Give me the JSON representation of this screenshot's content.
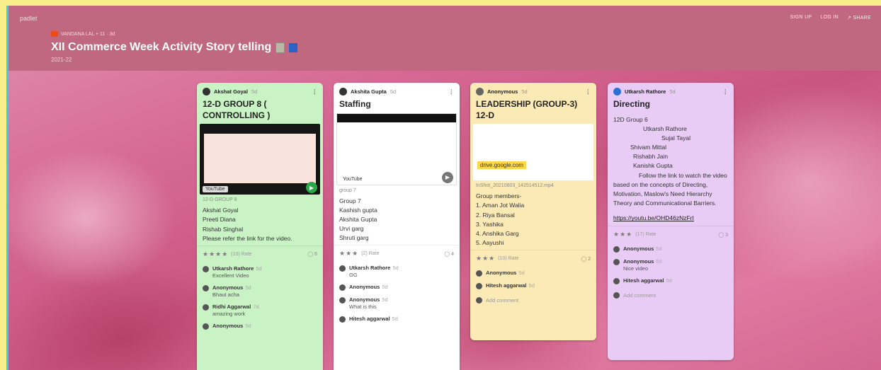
{
  "header": {
    "logo": "padlet",
    "author_line": "VANDANA LAL  +  11  ·  3d",
    "title": "XII Commerce Week Activity Story telling",
    "year": "2021-22",
    "actions": [
      "SIGN UP",
      "LOG IN",
      "SHARE"
    ]
  },
  "cards": [
    {
      "author": "Akshat Goyal",
      "time": "5d",
      "title": "12-D GROUP 8 ( CONTROLLING )",
      "thumb_label": "YouTube",
      "caption": "12-D GROUP 8",
      "body": [
        "Akshat Goyal",
        "Preeti Diana",
        "Rishab Singhal",
        "Please refer the link for the video."
      ],
      "rating_text": "(10) Rate",
      "comment_count": "6",
      "comments": [
        {
          "name": "Utkarsh Rathore",
          "time": "5d",
          "text": "Excellent Video"
        },
        {
          "name": "Anonymous",
          "time": "5d",
          "text": "Bhaut acha"
        },
        {
          "name": "Ridhi Aggarwal",
          "time": "7d",
          "text": "amazing work"
        },
        {
          "name": "Anonymous",
          "time": "5d",
          "text": ""
        }
      ]
    },
    {
      "author": "Akshita Gupta",
      "time": "5d",
      "title": "Staffing",
      "thumb_label": "YouTube",
      "caption": "group 7",
      "body": [
        "Group 7",
        "Kashish gupta",
        "Akshita Gupta",
        "Urvi garg",
        "Shruti garg"
      ],
      "rating_text": "(2) Rate",
      "comment_count": "4",
      "comments": [
        {
          "name": "Utkarsh Rathore",
          "time": "5d",
          "text": "GG"
        },
        {
          "name": "Anonymous",
          "time": "5d",
          "text": ""
        },
        {
          "name": "Anonymous",
          "time": "5d",
          "text": "What is this"
        },
        {
          "name": "Hitesh aggarwal",
          "time": "5d",
          "text": ""
        }
      ]
    },
    {
      "author": "Anonymous",
      "time": "5d",
      "title": "LEADERSHIP (GROUP-3) 12-D",
      "thumb_label": "drive.google.com",
      "caption": "InShot_20210803_142514512.mp4",
      "body": [
        "Group members-",
        "1. Aman Jot Walia",
        "2. Riya Bansal",
        "3. Yashika",
        "4. Anshika Garg",
        "5. Aayushi"
      ],
      "rating_text": "(10) Rate",
      "comment_count": "2",
      "comments": [
        {
          "name": "Anonymous",
          "time": "5d",
          "text": ""
        },
        {
          "name": "Hitesh aggarwal",
          "time": "5d",
          "text": ""
        }
      ],
      "add_comment": "Add comment"
    },
    {
      "author": "Utkarsh Rathore",
      "time": "5d",
      "title": "Directing",
      "body_lines": [
        "12D Group 6",
        "Utkarsh Rathore",
        "Sujal Tayal",
        "Shivam Mittal",
        "Rishabh Jain",
        "Kanishk Gupta",
        "Follow the link to watch the video based on the concepts of Directing, Motivation, Maslow's Need Hierarchy Theory and Communicational Barriers."
      ],
      "link": "https://youtu.be/OHD46zNzFrI",
      "rating_text": "(17) Rate",
      "comment_count": "3",
      "comments": [
        {
          "name": "Anonymous",
          "time": "5d",
          "text": ""
        },
        {
          "name": "Anonymous",
          "time": "5d",
          "text": "Nice video"
        },
        {
          "name": "Hitesh aggarwal",
          "time": "5d",
          "text": ""
        }
      ],
      "add_comment": "Add comment"
    }
  ]
}
